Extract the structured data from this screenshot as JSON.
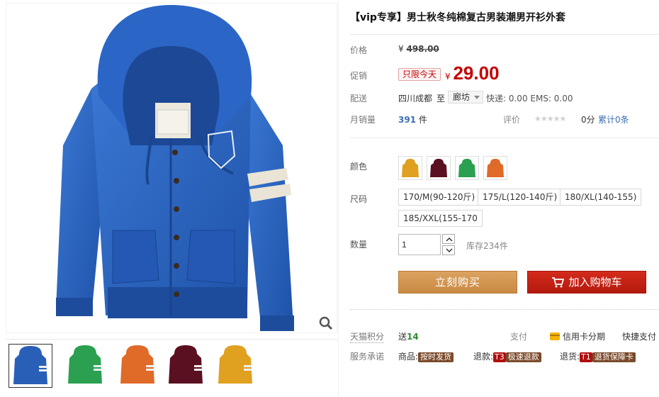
{
  "product": {
    "title": "【vip专享】男士秋冬纯棉复古男装潮男开衫外套"
  },
  "price": {
    "label": "价格",
    "currency": "¥",
    "original": "498.00"
  },
  "promo": {
    "label": "促销",
    "tag": "只限今天",
    "currency": "¥",
    "price": "29.00"
  },
  "shipping": {
    "label": "配送",
    "from": "四川成都",
    "to_word": "至",
    "destination": "廊坊",
    "fees": "快递: 0.00 EMS: 0.00"
  },
  "sales": {
    "label": "月销量",
    "count": "391",
    "unit": "件",
    "rating_label": "评价",
    "stars": "★★★★★",
    "score": "0分",
    "reviews": "累计0条"
  },
  "color": {
    "label": "颜色",
    "options": [
      {
        "name": "yellow",
        "hex": "#e0a020"
      },
      {
        "name": "maroon",
        "hex": "#5a1020"
      },
      {
        "name": "green",
        "hex": "#2aa050"
      },
      {
        "name": "orange",
        "hex": "#e06a28"
      }
    ]
  },
  "size": {
    "label": "尺码",
    "options": [
      "170/M(90-120斤)",
      "175/L(120-140斤)",
      "180/XL(140-155)",
      "185/XXL(155-170"
    ]
  },
  "quantity": {
    "label": "数量",
    "value": "1",
    "stock": "库存234件"
  },
  "actions": {
    "buy_now": "立刻购买",
    "add_cart": "加入购物车"
  },
  "points": {
    "label": "天猫积分",
    "prefix": "送",
    "value": "14",
    "pay_label": "支付",
    "credit": "信用卡分期",
    "quick": "快捷支付"
  },
  "service": {
    "label": "服务承诺",
    "goods_prefix": "商品:",
    "goods_tag": "按时发货",
    "refund_prefix": "退款:",
    "refund_code": "T3",
    "refund_tag": "极速退款",
    "return_prefix": "退货:",
    "return_code": "T1",
    "return_tag": "退货保障卡"
  },
  "gallery": {
    "thumb_colors": [
      "#2a5fb8",
      "#2aa050",
      "#e06a28",
      "#5a1020",
      "#e0a020"
    ],
    "main_color": "#2a62c0",
    "zoom_icon": "magnifier-icon"
  },
  "colors": {
    "accent_red": "#c40000",
    "buy_now": "#d39a52",
    "add_cart": "#c0231a",
    "link": "#3d6fb3"
  }
}
